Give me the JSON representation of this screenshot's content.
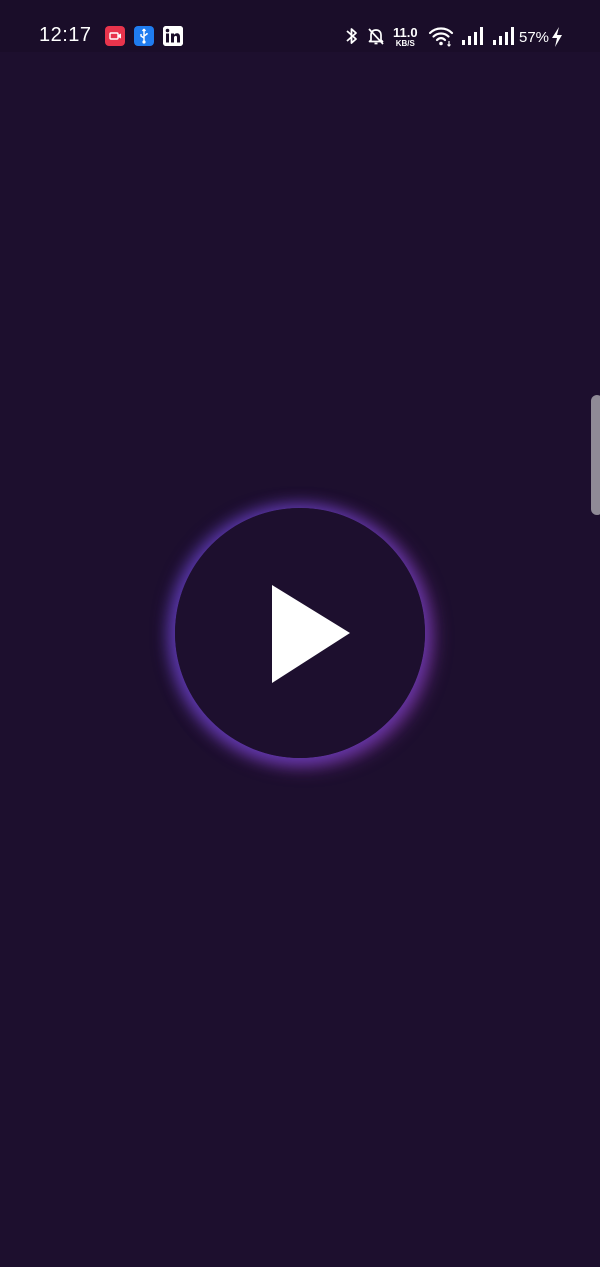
{
  "status_bar": {
    "time": "12:17",
    "notification_icons": [
      "screen-record-icon",
      "usb-icon",
      "linkedin-icon"
    ],
    "net_speed_value": "11.0",
    "net_speed_unit": "KB/S",
    "battery_percent": "57%",
    "system_icons": [
      "bluetooth-icon",
      "bell-off-icon",
      "wifi-icon",
      "signal-icon",
      "signal-icon",
      "charging-icon"
    ]
  },
  "colors": {
    "background": "#1d0f2e",
    "status_bar": "#1a0d29",
    "record_badge": "#e8344c",
    "usb_badge": "#1f7cf0",
    "glow": "#8a3ec8",
    "play_icon": "#ffffff"
  },
  "player": {
    "play_icon": "play-icon"
  }
}
